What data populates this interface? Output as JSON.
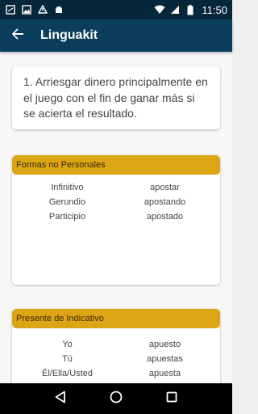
{
  "status_bar": {
    "time": "11:50",
    "icons": [
      "notification-icon",
      "image-icon",
      "upload-icon",
      "android-icon",
      "wifi-icon",
      "signal-icon",
      "battery-icon"
    ]
  },
  "app_bar": {
    "title": "Linguakit",
    "icon": "arrow-back-icon",
    "background": "#0b3e5c"
  },
  "definition": {
    "text": "1. Arriesgar dinero principalmente en el juego con el fin de ganar más si se acierta el resultado."
  },
  "sections": [
    {
      "title": "Formas no Personales",
      "rows": [
        {
          "label": "Infinitivo",
          "value": "apostar"
        },
        {
          "label": "Gerundio",
          "value": "apostando"
        },
        {
          "label": "Participio",
          "value": "apostado"
        }
      ]
    },
    {
      "title": "Presente de Indicativo",
      "rows": [
        {
          "label": "Yo",
          "value": "apuesto"
        },
        {
          "label": "Tú",
          "value": "apuestas"
        },
        {
          "label": "Él/Ella/Usted",
          "value": "apuesta"
        }
      ]
    }
  ],
  "colors": {
    "accent": "#dba515",
    "status_bar": "#06263a"
  },
  "nav_bar": {
    "icons": [
      "back-triangle-icon",
      "home-circle-icon",
      "recents-square-icon"
    ]
  }
}
